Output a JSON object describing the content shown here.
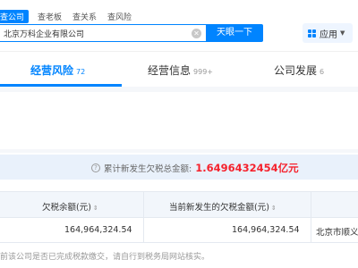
{
  "search": {
    "tabs": [
      {
        "label": "查公司",
        "active": true
      },
      {
        "label": "查老板",
        "active": false
      },
      {
        "label": "查关系",
        "active": false
      },
      {
        "label": "查风险",
        "active": false
      }
    ],
    "input_value": "北京万科企业有限公司",
    "button_label": "天眼一下",
    "apps_label": "应用"
  },
  "main_tabs": [
    {
      "label": "经营风险",
      "count": "72",
      "active": true
    },
    {
      "label": "经营信息",
      "count": "999+",
      "active": false
    },
    {
      "label": "公司发展",
      "count": "6",
      "active": false
    }
  ],
  "summary": {
    "label": "累计新发生欠税总金额:",
    "value": "1.6496432454",
    "unit": "亿元"
  },
  "table": {
    "headers": [
      "欠税余额(元)",
      "当前新发生的欠税金额(元)"
    ],
    "rows": [
      [
        "164,964,324.54",
        "164,964,324.54",
        "北京市顺义"
      ]
    ]
  },
  "footnote": "前该公司是否已完成税款缴交，请自行到税务局网站核实。",
  "colors": {
    "accent": "#0084ff",
    "amount": "#f5222d"
  },
  "icons": [
    "clear-icon",
    "apps-grid-icon",
    "question-icon",
    "sort-icon"
  ]
}
